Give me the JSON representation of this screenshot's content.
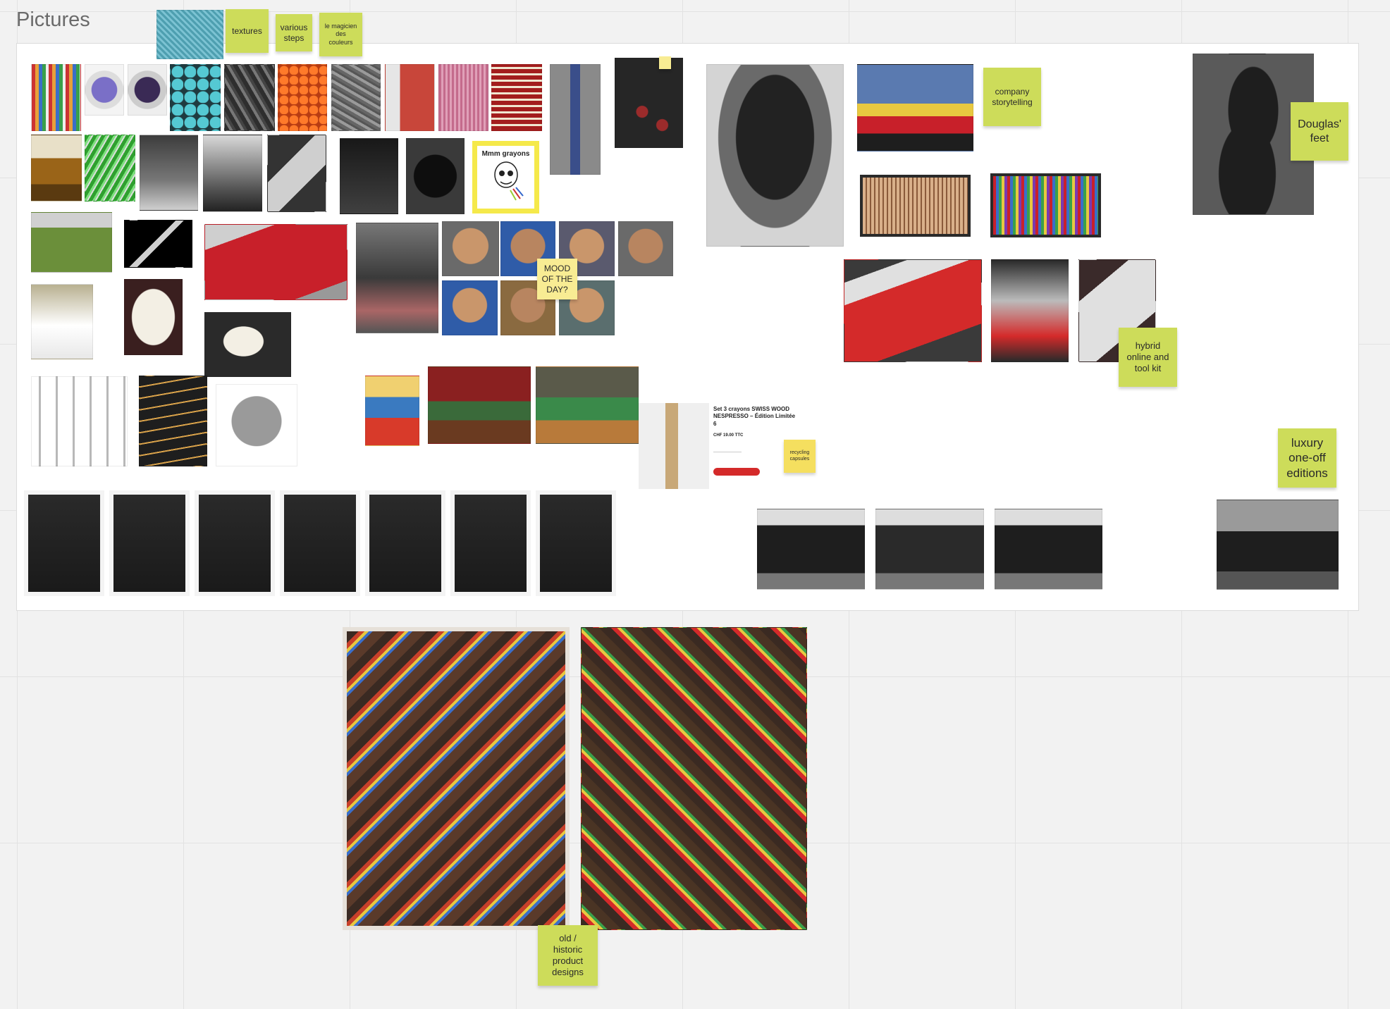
{
  "board": {
    "frame_title": "Pictures"
  },
  "stickies": {
    "textures": "textures",
    "various_steps": "various\nsteps",
    "magicien": "le magicien\ndes\ncouleurs",
    "company_storytelling": "company\nstorytelling",
    "douglas_feet": "Douglas'\nfeet",
    "mood_of_the_day": "MOOD\nOF THE\nDAY?",
    "hybrid_toolkit": "hybrid\nonline and\ntool kit",
    "luxury_editions": "luxury\none-off\neditions",
    "recycling_capsules": "recycling\ncapsules",
    "old_historic": "old /\nhistoric\nproduct\ndesigns"
  },
  "meme": {
    "caption": "Mmm grayons"
  },
  "product_card": {
    "title": "Set 3 crayons SWISS WOOD\nNESPRESSO – Édition Limitée\n6",
    "price": "CHF 19.00 TTC"
  },
  "colors": {
    "sticky_green": "#cddc5a",
    "sticky_yellow": "#f5df5f",
    "sticky_pale": "#f8ec93",
    "canvas": "#f2f2f2",
    "frame": "#ffffff",
    "meme_border": "#f5e94a"
  }
}
